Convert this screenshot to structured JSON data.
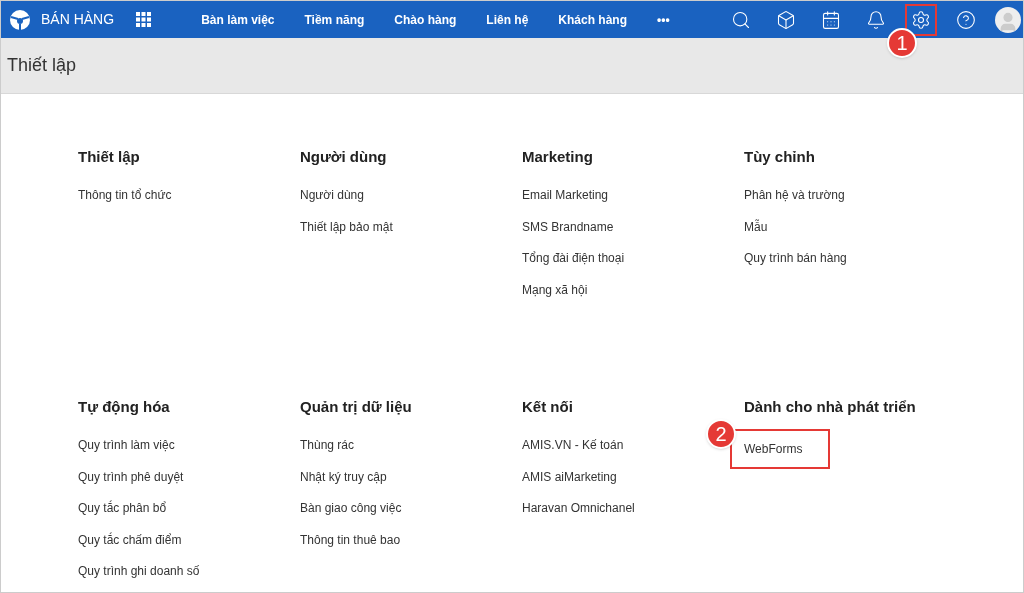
{
  "app": {
    "title": "BÁN HÀNG"
  },
  "nav": [
    {
      "label": "Bàn làm việc"
    },
    {
      "label": "Tiềm năng"
    },
    {
      "label": "Chào hàng"
    },
    {
      "label": "Liên hệ"
    },
    {
      "label": "Khách hàng"
    },
    {
      "label": "•••"
    }
  ],
  "toolbar": [
    {
      "kind": "search"
    },
    {
      "kind": "box"
    },
    {
      "kind": "calendar"
    },
    {
      "kind": "bell"
    },
    {
      "kind": "settings",
      "callout": "1"
    },
    {
      "kind": "help"
    },
    {
      "kind": "avatar"
    }
  ],
  "page_title": "Thiết lập",
  "groups": [
    {
      "title": "Thiết lập",
      "items": [
        {
          "label": "Thông tin tổ chức"
        }
      ]
    },
    {
      "title": "Người dùng",
      "items": [
        {
          "label": "Người dùng"
        },
        {
          "label": "Thiết lập bảo mật"
        }
      ]
    },
    {
      "title": "Marketing",
      "items": [
        {
          "label": "Email Marketing"
        },
        {
          "label": "SMS Brandname"
        },
        {
          "label": "Tổng đài điện thoại"
        },
        {
          "label": "Mạng xã hội"
        }
      ]
    },
    {
      "title": "Tùy chỉnh",
      "items": [
        {
          "label": "Phân hệ và trường"
        },
        {
          "label": "Mẫu"
        },
        {
          "label": "Quy trình bán hàng"
        }
      ]
    },
    {
      "title": "Tự động hóa",
      "items": [
        {
          "label": "Quy trình làm việc"
        },
        {
          "label": "Quy trình phê duyệt"
        },
        {
          "label": "Quy tắc phân bổ"
        },
        {
          "label": "Quy tắc chấm điểm"
        },
        {
          "label": "Quy trình ghi doanh số"
        }
      ]
    },
    {
      "title": "Quản trị dữ liệu",
      "items": [
        {
          "label": "Thùng rác"
        },
        {
          "label": "Nhật ký truy cập"
        },
        {
          "label": "Bàn giao công việc"
        },
        {
          "label": "Thông tin thuê bao"
        }
      ]
    },
    {
      "title": "Kết nối",
      "items": [
        {
          "label": "AMIS.VN - Kế toán"
        },
        {
          "label": "AMIS aiMarketing"
        },
        {
          "label": "Haravan Omnichanel"
        }
      ]
    },
    {
      "title": "Dành cho nhà phát triển",
      "items": [
        {
          "label": "WebForms",
          "callout": "2"
        }
      ]
    }
  ]
}
